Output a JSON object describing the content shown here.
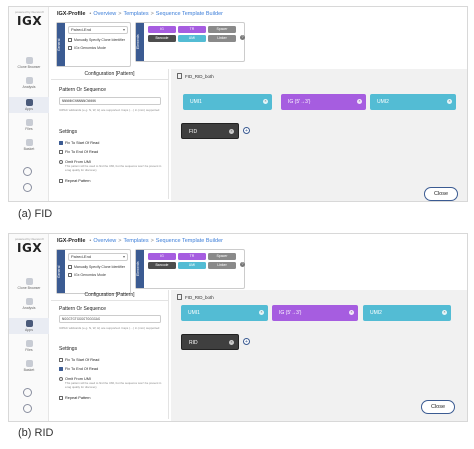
{
  "screens": [
    {
      "caption": "(a) FID",
      "brand_tag": "powered by iGenomX",
      "brand": "IGX",
      "header": {
        "title": "IGX-Profile",
        "crumbs": [
          "Overview",
          "Templates",
          "Sequence Template Builder"
        ]
      },
      "nav": [
        "Clone Browser",
        "Analysis",
        "Apps",
        "Files",
        "Basket"
      ],
      "general": {
        "tab": "General",
        "select_value": "Paired-End",
        "checks": [
          "Manually Specify Clone Identifier",
          "IGx Genomics Mode"
        ]
      },
      "elements": {
        "tab": "Elements",
        "chips": [
          "IG",
          "TR",
          "Spacer",
          "Barcode",
          "UMI",
          "Linker"
        ]
      },
      "config": {
        "title": "Configuration [Pattern]",
        "pattern_label": "Pattern Or Sequence",
        "pattern_value": "NNNNNCNNNNNCNNNN",
        "pattern_hint": "IUPAC wildcards (e.g. N, W, H) are supported. Caps (…) in (mm) supported",
        "settings_label": "Settings",
        "options": [
          {
            "label": "Fix To Start Of Read",
            "checked": true
          },
          {
            "label": "Fix To End Of Read",
            "checked": false
          },
          {
            "label": "Omit From UMI",
            "checked": false
          },
          {
            "label": "Repeat Pattern",
            "checked": false
          }
        ],
        "omit_hint": "This pattern will be used to find the UMI, but the sequence won't be present in a tag quality for discovery"
      },
      "builder": {
        "file": "FID_RID_both",
        "segments": [
          "UMI1",
          "IG (5'→3')",
          "UMI2"
        ],
        "selected": "FID",
        "close": "Close"
      }
    },
    {
      "caption": "(b) RID",
      "brand_tag": "powered by iGenomX",
      "brand": "IGX",
      "header": {
        "title": "IGX-Profile",
        "crumbs": [
          "Overview",
          "Templates",
          "Sequence Template Builder"
        ]
      },
      "nav": [
        "Clone Browser",
        "Analysis",
        "Apps",
        "Files",
        "Basket"
      ],
      "general": {
        "tab": "General",
        "select_value": "Paired-End",
        "checks": [
          "Manually Specify Clone Identifier",
          "IGx Genomics Mode"
        ]
      },
      "elements": {
        "tab": "Elements",
        "chips": [
          "IG",
          "TR",
          "Spacer",
          "Barcode",
          "UMI",
          "Linker"
        ]
      },
      "config": {
        "title": "Configuration [Pattern]",
        "pattern_label": "Pattern Or Sequence",
        "pattern_value": "NGGGTGTGGGGTGGGGAG",
        "pattern_hint": "IUPAC wildcards (e.g. N, W, H) are supported. Caps (…) in (mm) supported",
        "settings_label": "Settings",
        "options": [
          {
            "label": "Fix To Start Of Read",
            "checked": false
          },
          {
            "label": "Fix To End Of Read",
            "checked": true
          },
          {
            "label": "Omit From UMI",
            "checked": false
          },
          {
            "label": "Repeat Pattern",
            "checked": false
          }
        ],
        "omit_hint": "This pattern will be used to find the UMI, but the sequence won't be present in a tag quality for discovery"
      },
      "builder": {
        "file": "FID_RID_both",
        "segments": [
          "UMI1",
          "IG (5'→3')",
          "UMI2"
        ],
        "selected": "RID",
        "close": "Close"
      }
    }
  ],
  "colors": {
    "navy": "#3b5b92",
    "purple": "#a65de0",
    "teal": "#53bcd4",
    "link": "#3b7dd8"
  }
}
